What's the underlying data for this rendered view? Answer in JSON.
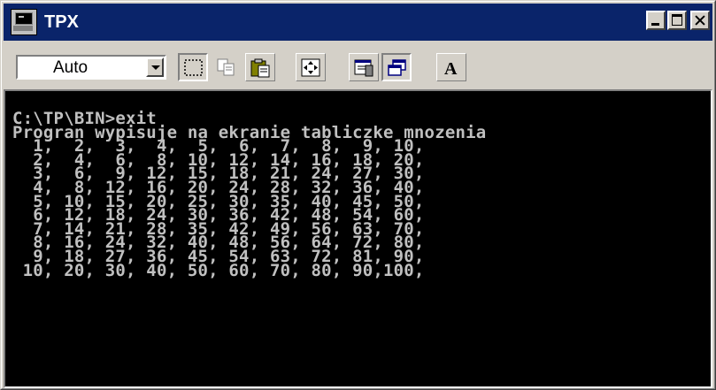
{
  "window": {
    "title": "TPX"
  },
  "toolbar": {
    "font_size_value": "Auto",
    "font_size_placeholder": "Auto",
    "tools": [
      {
        "name": "mark-icon"
      },
      {
        "name": "copy-icon"
      },
      {
        "name": "paste-icon"
      },
      {
        "name": "fullscreen-icon"
      },
      {
        "name": "properties-icon"
      },
      {
        "name": "background-icon"
      },
      {
        "name": "font-icon",
        "glyph": "A"
      }
    ]
  },
  "console": {
    "lines": [
      "C:\\TP\\BIN>exit",
      "Progran wypisuje na ekranie tabliczke mnozenia",
      "  1,  2,  3,  4,  5,  6,  7,  8,  9, 10,",
      "  2,  4,  6,  8, 10, 12, 14, 16, 18, 20,",
      "  3,  6,  9, 12, 15, 18, 21, 24, 27, 30,",
      "  4,  8, 12, 16, 20, 24, 28, 32, 36, 40,",
      "  5, 10, 15, 20, 25, 30, 35, 40, 45, 50,",
      "  6, 12, 18, 24, 30, 36, 42, 48, 54, 60,",
      "  7, 14, 21, 28, 35, 42, 49, 56, 63, 70,",
      "  8, 16, 24, 32, 40, 48, 56, 64, 72, 80,",
      "  9, 18, 27, 36, 45, 54, 63, 72, 81, 90,",
      " 10, 20, 30, 40, 50, 60, 70, 80, 90,100,"
    ]
  },
  "colors": {
    "titlebar": "#0a246a",
    "console_bg": "#000000",
    "console_text": "#c0c0c0",
    "chrome": "#d4d0c8"
  }
}
